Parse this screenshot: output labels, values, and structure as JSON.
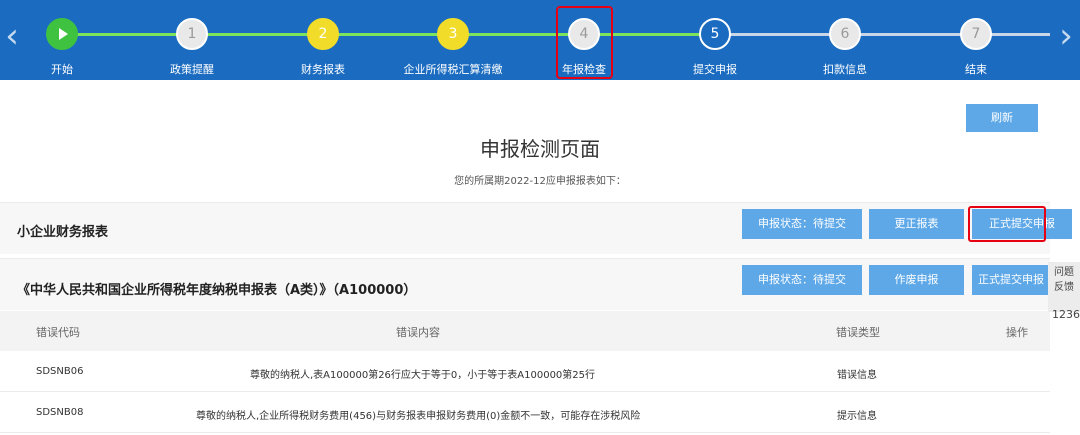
{
  "stepper": {
    "prev_icon": "chevron-left-icon",
    "next_icon": "chevron-right-icon",
    "steps": [
      {
        "number": "",
        "label": "开始",
        "state": "start"
      },
      {
        "number": "1",
        "label": "政策提醒",
        "state": "pending"
      },
      {
        "number": "2",
        "label": "财务报表",
        "state": "active"
      },
      {
        "number": "3",
        "label": "企业所得税汇算清缴",
        "state": "active"
      },
      {
        "number": "4",
        "label": "年报检查",
        "state": "pending"
      },
      {
        "number": "5",
        "label": "提交申报",
        "state": "current"
      },
      {
        "number": "6",
        "label": "扣款信息",
        "state": "pending"
      },
      {
        "number": "7",
        "label": "结束",
        "state": "pending"
      }
    ]
  },
  "header": {
    "refresh_label": "刷新",
    "title": "申报检测页面",
    "subtitle": "您的所属期2022-12应申报报表如下："
  },
  "sections": [
    {
      "title": "小企业财务报表",
      "buttons": [
        "申报状态：待提交",
        "更正报表",
        "正式提交申报"
      ]
    },
    {
      "title": "《中华人民共和国企业所得税年度纳税申报表（A类）》（A100000）",
      "buttons": [
        "申报状态：待提交",
        "作废申报",
        "正式提交申报"
      ]
    }
  ],
  "table": {
    "headers": [
      "错误代码",
      "错误内容",
      "错误类型",
      "操作"
    ],
    "rows": [
      {
        "code": "SDSNB06",
        "content": "尊敬的纳税人,表A100000第26行应大于等于0，小于等于表A100000第25行",
        "type": "错误信息",
        "action": ""
      },
      {
        "code": "SDSNB08",
        "content": "尊敬的纳税人,企业所得税财务费用(456)与财务报表申报财务费用(0)金额不一致，可能存在涉税风险",
        "type": "提示信息",
        "action": ""
      }
    ]
  },
  "side_widget": {
    "label_line1": "问题",
    "label_line2": "反馈",
    "number": "1236"
  },
  "colors": {
    "stepper_bg": "#1b6cc0",
    "button_bg": "#5ea8e8",
    "progress_done": "#7ee35d",
    "step_active": "#f1dc2a",
    "highlight": "#e60012"
  }
}
